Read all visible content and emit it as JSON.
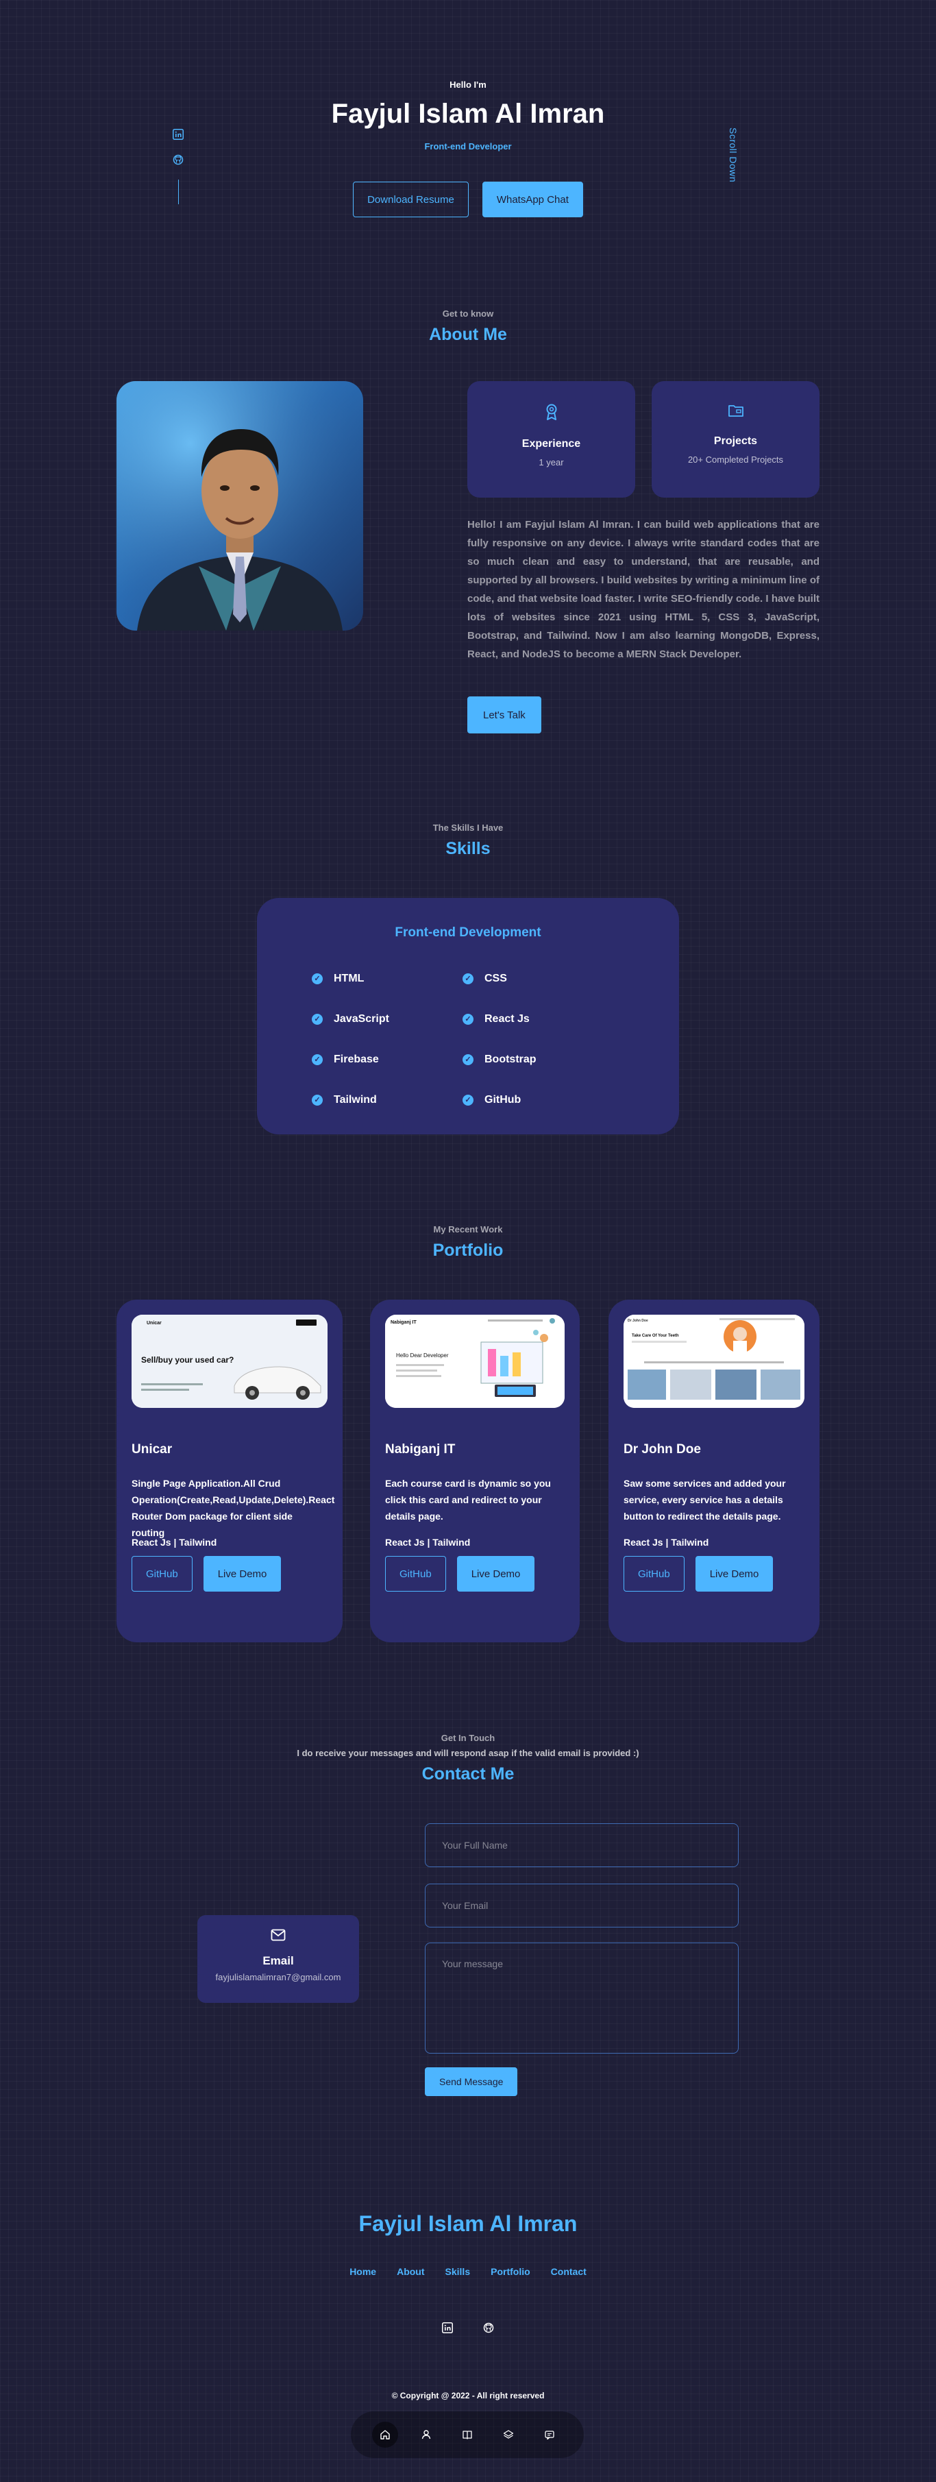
{
  "hero": {
    "greeting": "Hello I'm",
    "name": "Fayjul Islam Al Imran",
    "role": "Front-end Developer",
    "download_resume": "Download Resume",
    "whatsapp_chat": "WhatsApp Chat",
    "scroll_down": "Scroll Down",
    "socials": [
      "linkedin-icon",
      "github-icon"
    ]
  },
  "about": {
    "subtitle": "Get to know",
    "title": "About Me",
    "cards": [
      {
        "icon": "award-icon",
        "title": "Experience",
        "value": "1 year"
      },
      {
        "icon": "folder-icon",
        "title": "Projects",
        "value": "20+ Completed Projects"
      }
    ],
    "text": "Hello! I am Fayjul Islam Al Imran. I can build web applications that are fully responsive on any device. I always write standard codes that are so much clean and easy to understand, that are reusable, and supported by all browsers. I build websites by writing a minimum line of code, and that website load faster. I write SEO-friendly code. I have built lots of websites since 2021 using HTML 5, CSS 3, JavaScript, Bootstrap, and Tailwind. Now I am also learning MongoDB, Express, React, and NodeJS to become a MERN Stack Developer.",
    "cta": "Let's Talk"
  },
  "skills": {
    "subtitle": "The Skills I Have",
    "title": "Skills",
    "card_title": "Front-end Development",
    "items": [
      "HTML",
      "CSS",
      "JavaScript",
      "React Js",
      "Firebase",
      "Bootstrap",
      "Tailwind",
      "GitHub"
    ]
  },
  "portfolio": {
    "subtitle": "My Recent Work",
    "title": "Portfolio",
    "projects": [
      {
        "title": "Unicar",
        "description": "Single Page Application.All Crud Operation(Create,Read,Update,Delete).React Router Dom package for client side routing",
        "tech": "React Js | Tailwind",
        "github": "GitHub",
        "demo": "Live Demo",
        "thumb": {
          "logo": "Unicar",
          "headline": "Sell/buy your used car?"
        }
      },
      {
        "title": "Nabiganj IT",
        "description": "Each course card is dynamic so you click this card and redirect to your details page.",
        "tech": "React Js | Tailwind",
        "github": "GitHub",
        "demo": "Live Demo",
        "thumb": {
          "logo": "Nabiganj IT",
          "headline": "Hello Dear Developer"
        }
      },
      {
        "title": "Dr John Doe",
        "description": "Saw some services and added your service, every service has a details button to redirect the details page.",
        "tech": "React Js | Tailwind",
        "github": "GitHub",
        "demo": "Live Demo",
        "thumb": {
          "logo": "Dr John Doe",
          "headline": "Take Care Of Your Teeth"
        }
      }
    ]
  },
  "contact": {
    "subtitle": "Get In Touch",
    "note": "I do receive your messages and will respond asap if the valid email is provided :)",
    "title": "Contact Me",
    "email_label": "Email",
    "email_value": "fayjulislamalimran7@gmail.com",
    "name_placeholder": "Your Full Name",
    "email_placeholder": "Your Email",
    "message_placeholder": "Your message",
    "send": "Send Message"
  },
  "footer": {
    "name": "Fayjul Islam Al Imran",
    "nav": [
      "Home",
      "About",
      "Skills",
      "Portfolio",
      "Contact"
    ],
    "copyright": "© Copyright @ 2022 - All right reserved"
  },
  "colors": {
    "bg": "#1f1f38",
    "card": "#2c2c6c",
    "accent": "#4db5ff"
  }
}
